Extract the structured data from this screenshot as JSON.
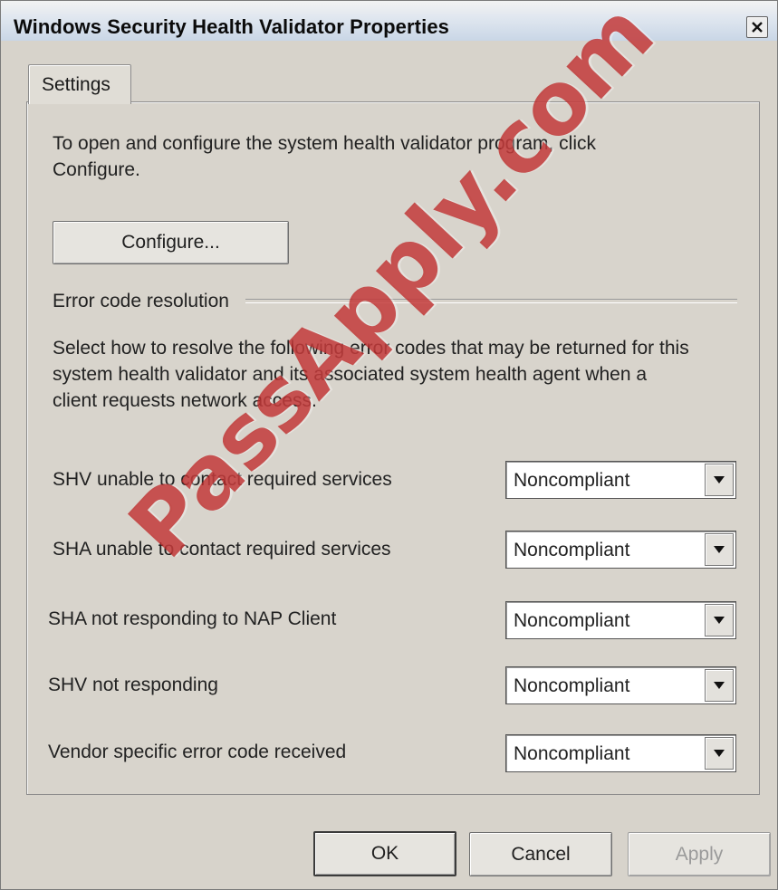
{
  "window": {
    "title": "Windows Security Health Validator Properties"
  },
  "tabs": [
    {
      "label": "Settings"
    }
  ],
  "settings": {
    "intro_line1": "To open and configure the system health validator program, click",
    "intro_line2": "Configure.",
    "configure_label": "Configure...",
    "group_title": "Error code resolution",
    "desc_line1": "Select how to resolve the following error codes that may be returned for this",
    "desc_line2": "system health validator and its associated system health agent when a",
    "desc_line3": "client requests network access.",
    "rows": [
      {
        "label": "SHV unable to contact required services",
        "value": "Noncompliant"
      },
      {
        "label": "SHA unable to contact required services",
        "value": "Noncompliant"
      },
      {
        "label": "SHA not responding to NAP Client",
        "value": "Noncompliant"
      },
      {
        "label": "SHV not responding",
        "value": "Noncompliant"
      },
      {
        "label": "Vendor specific error code received",
        "value": "Noncompliant"
      }
    ]
  },
  "footer": {
    "ok_label": "OK",
    "cancel_label": "Cancel",
    "apply_label": "Apply"
  },
  "watermark": "PassApply.com",
  "icons": {
    "close": "close-icon",
    "dropdown": "chevron-down-icon"
  },
  "colors": {
    "watermark": "#be2828",
    "dialog_bg": "#d4d0c8"
  }
}
